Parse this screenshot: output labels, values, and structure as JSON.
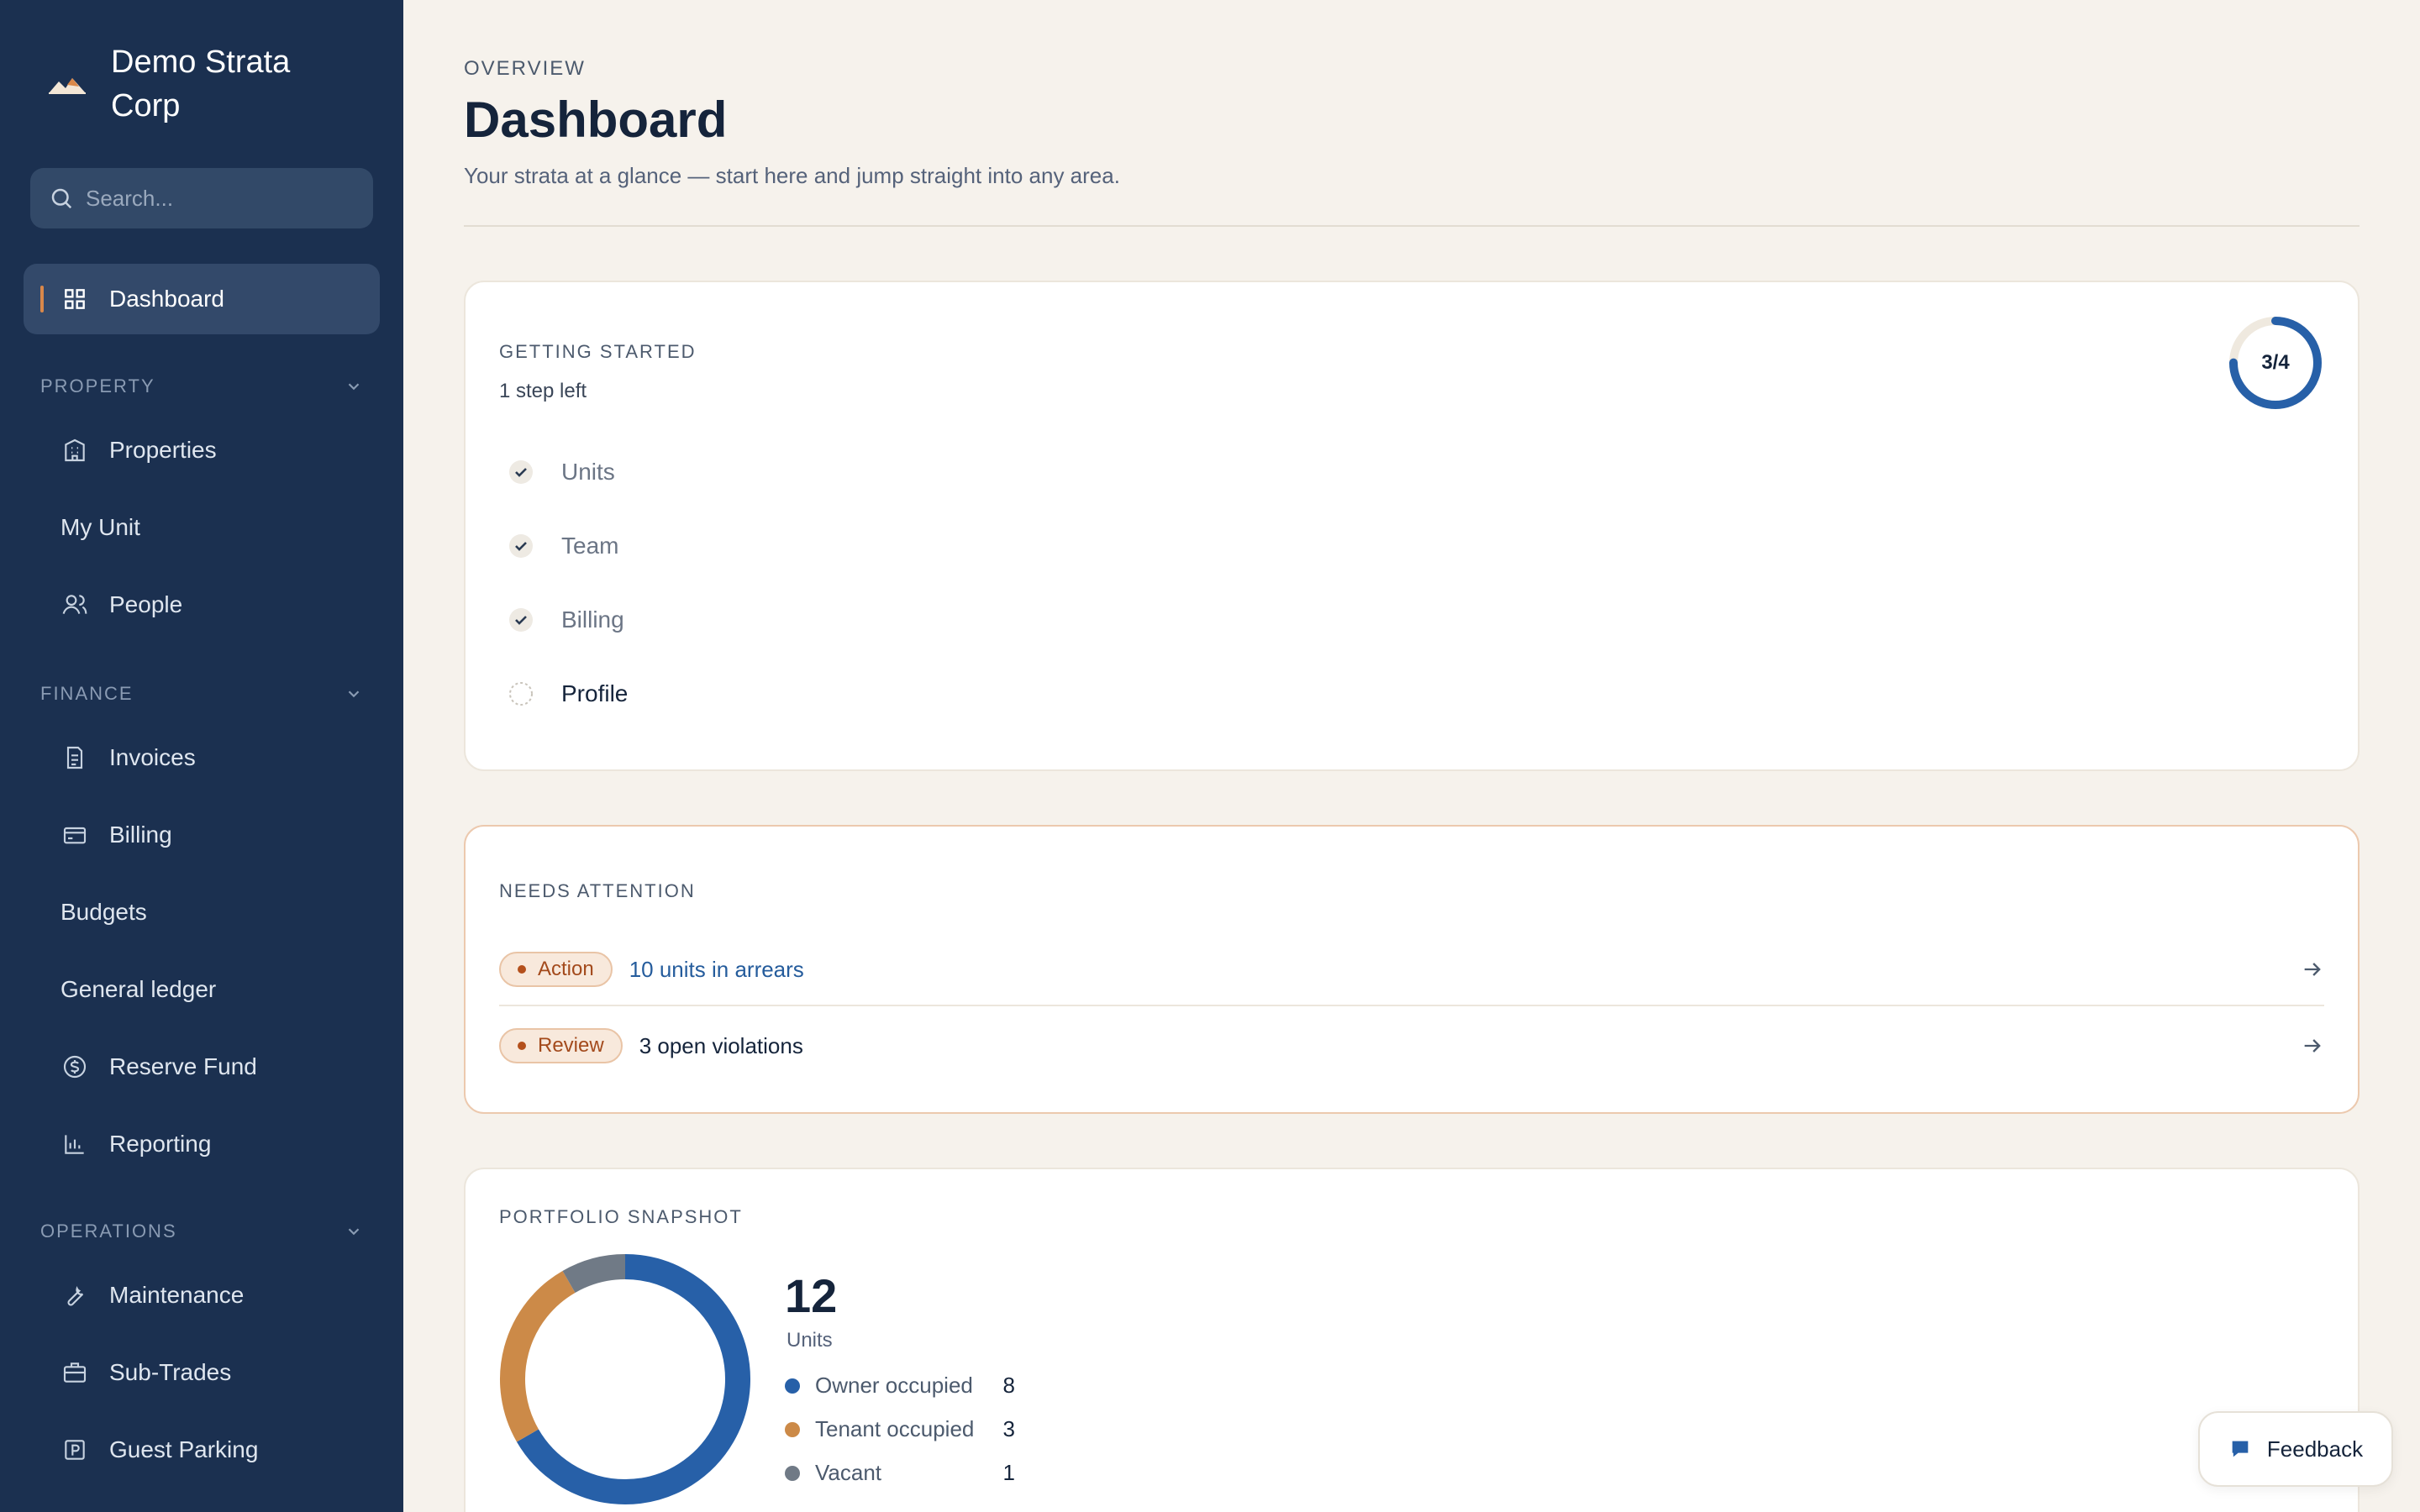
{
  "brand": {
    "name": "Demo Strata Corp"
  },
  "search": {
    "placeholder": "Search..."
  },
  "sidebar": {
    "dashboard": "Dashboard",
    "sections": {
      "property": "PROPERTY",
      "finance": "FINANCE",
      "operations": "OPERATIONS"
    },
    "property_items": [
      "Properties",
      "My Unit",
      "People"
    ],
    "finance_items": [
      "Invoices",
      "Billing",
      "Budgets",
      "General ledger",
      "Reserve Fund",
      "Reporting"
    ],
    "operations_items": [
      "Maintenance",
      "Sub-Trades",
      "Guest Parking"
    ]
  },
  "header": {
    "eyebrow": "OVERVIEW",
    "title": "Dashboard",
    "subtitle": "Your strata at a glance — start here and jump straight into any area."
  },
  "getting_started": {
    "eyebrow": "GETTING STARTED",
    "steps_left": "1 step left",
    "progress_label": "3/4",
    "progress": 0.75,
    "steps": [
      {
        "label": "Units",
        "done": true
      },
      {
        "label": "Team",
        "done": true
      },
      {
        "label": "Billing",
        "done": true
      },
      {
        "label": "Profile",
        "done": false
      }
    ]
  },
  "attention": {
    "eyebrow": "NEEDS ATTENTION",
    "items": [
      {
        "badge": "Action",
        "text": "10 units in arrears"
      },
      {
        "badge": "Review",
        "text": "3 open violations"
      }
    ]
  },
  "snapshot": {
    "eyebrow": "PORTFOLIO SNAPSHOT",
    "total": "12",
    "total_label": "Units",
    "segments": [
      {
        "label": "Owner occupied",
        "value": 8,
        "color": "#2760a8"
      },
      {
        "label": "Tenant occupied",
        "value": 3,
        "color": "#cc8a48"
      },
      {
        "label": "Vacant",
        "value": 1,
        "color": "#707a86"
      }
    ]
  },
  "feedback": {
    "label": "Feedback"
  }
}
